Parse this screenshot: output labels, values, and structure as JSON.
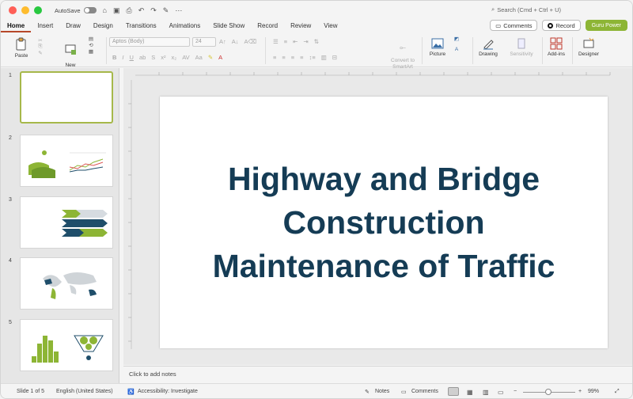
{
  "titlebar": {
    "autosave_label": "AutoSave",
    "search_placeholder": "Search (Cmd + Ctrl + U)"
  },
  "tabs": [
    {
      "label": "Home",
      "active": true
    },
    {
      "label": "Insert"
    },
    {
      "label": "Draw"
    },
    {
      "label": "Design"
    },
    {
      "label": "Transitions"
    },
    {
      "label": "Animations"
    },
    {
      "label": "Slide Show"
    },
    {
      "label": "Record"
    },
    {
      "label": "Review"
    },
    {
      "label": "View"
    }
  ],
  "tab_actions": {
    "comments": "Comments",
    "record": "Record",
    "guru": "Guru Power"
  },
  "ribbon": {
    "paste": "Paste",
    "new_slide": "New\nSlide",
    "font_name": "Aptos (Body)",
    "font_size": "24",
    "convert_smartart": "Convert to\nSmartArt",
    "picture": "Picture",
    "drawing": "Drawing",
    "sensitivity": "Sensitivity",
    "addins": "Add-ins",
    "designer": "Designer"
  },
  "thumbnails": [
    "1",
    "2",
    "3",
    "4",
    "5"
  ],
  "slide": {
    "title": "Highway and Bridge Construction Maintenance of Traffic"
  },
  "notes_placeholder": "Click to add notes",
  "status": {
    "slide_of": "Slide 1 of 5",
    "language": "English (United States)",
    "accessibility": "Accessibility: Investigate",
    "notes": "Notes",
    "comments": "Comments",
    "zoom": "99%"
  },
  "colors": {
    "title_navy": "#153c55",
    "accent_green": "#8db535",
    "ppt_red": "#b7472a"
  }
}
